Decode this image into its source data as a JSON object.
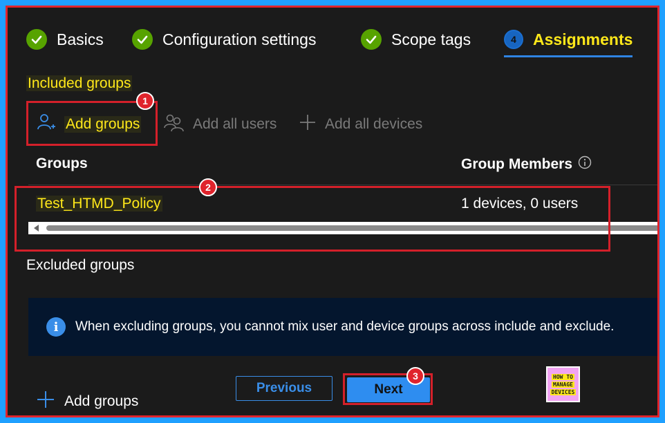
{
  "wizard": {
    "steps": [
      {
        "label": "Basics",
        "state": "done"
      },
      {
        "label": "Configuration settings",
        "state": "done"
      },
      {
        "label": "Scope tags",
        "state": "done"
      },
      {
        "label": "Assignments",
        "number": "4",
        "state": "active"
      }
    ]
  },
  "included": {
    "title": "Included groups",
    "toolbar": {
      "add_groups": "Add groups",
      "add_all_users": "Add all users",
      "add_all_devices": "Add all devices"
    },
    "table": {
      "columns": [
        "Groups",
        "Group Members"
      ],
      "rows": [
        {
          "group": "Test_HTMD_Policy",
          "members": "1 devices, 0 users"
        }
      ]
    }
  },
  "excluded": {
    "title": "Excluded groups",
    "info": "When excluding groups, you cannot mix user and device groups across include and exclude.",
    "add_groups": "Add groups"
  },
  "footer": {
    "previous": "Previous",
    "next": "Next"
  },
  "annotations": {
    "badge1": "1",
    "badge2": "2",
    "badge3": "3"
  },
  "logo": {
    "line1": "HOW TO",
    "line2": "MANAGE",
    "line3": "DEVICES"
  },
  "colors": {
    "background": "#1b1b1b",
    "accent": "#2e8df0",
    "highlight": "#ffe81a",
    "annotation": "#e0242c",
    "success": "#57a300"
  },
  "icons": [
    "checkmark-icon",
    "add-user-icon",
    "users-icon",
    "plus-icon",
    "info-icon",
    "info-circle-icon"
  ]
}
